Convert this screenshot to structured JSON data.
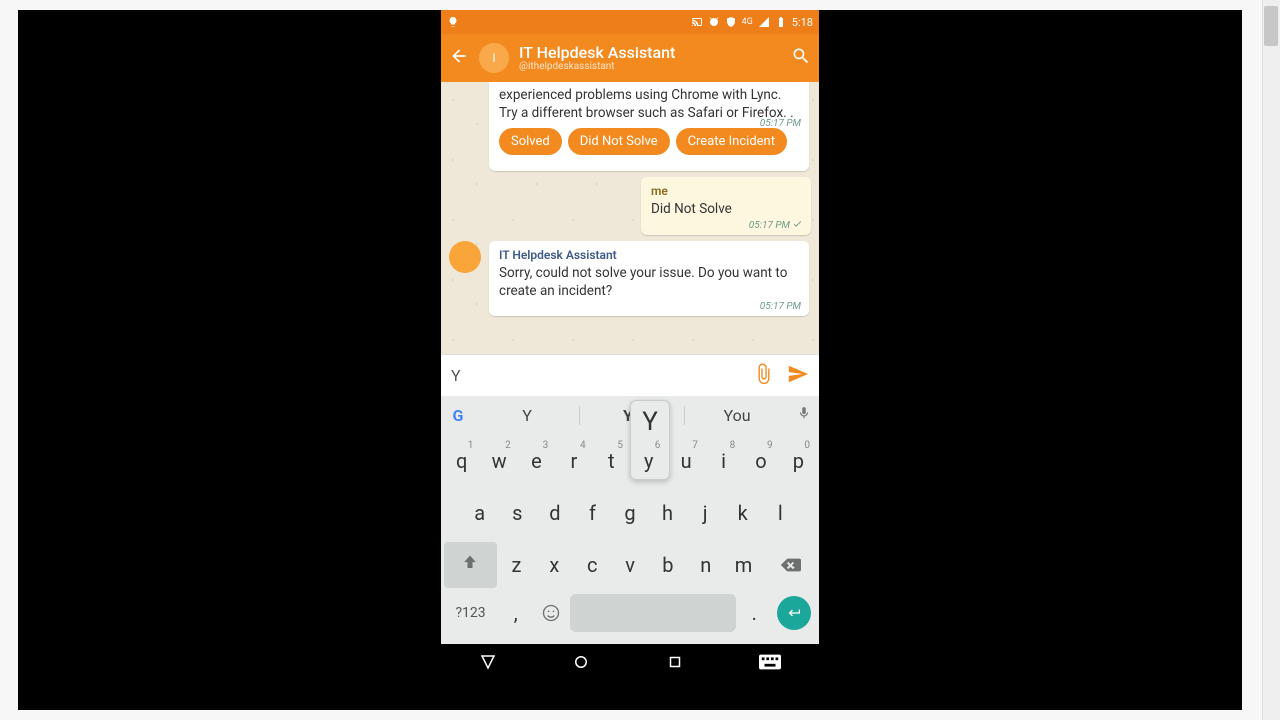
{
  "status": {
    "time": "5:18",
    "net": "4G"
  },
  "header": {
    "title": "IT Helpdesk Assistant",
    "handle": "@ithelpdeskassistant"
  },
  "chat": {
    "msg1_text": "experienced problems using Chrome with Lync.  Try a different browser such as Safari or Firefox.  .",
    "msg1_time": "05:17 PM",
    "quick_replies": {
      "a": "Solved",
      "b": "Did Not Solve",
      "c": "Create Incident"
    },
    "me_sender": "me",
    "me_text": "Did Not Solve",
    "me_time": "05:17 PM",
    "msg2_sender": "IT Helpdesk Assistant",
    "msg2_text": "Sorry, could not solve your issue. Do you want to create an incident?",
    "msg2_time": "05:17 PM"
  },
  "compose": {
    "value": "Y"
  },
  "suggestions": {
    "a": "Y",
    "b": "Ye",
    "c": "You"
  },
  "keyboard": {
    "popup": "Y",
    "row1": [
      "q",
      "w",
      "e",
      "r",
      "t",
      "y",
      "u",
      "i",
      "o",
      "p"
    ],
    "row1_sup": [
      "1",
      "2",
      "3",
      "4",
      "5",
      "6",
      "7",
      "8",
      "9",
      "0"
    ],
    "row2": [
      "a",
      "s",
      "d",
      "f",
      "g",
      "h",
      "j",
      "k",
      "l"
    ],
    "row3": [
      "z",
      "x",
      "c",
      "v",
      "b",
      "n",
      "m"
    ],
    "sym": "?123",
    "comma": ",",
    "period": "."
  }
}
